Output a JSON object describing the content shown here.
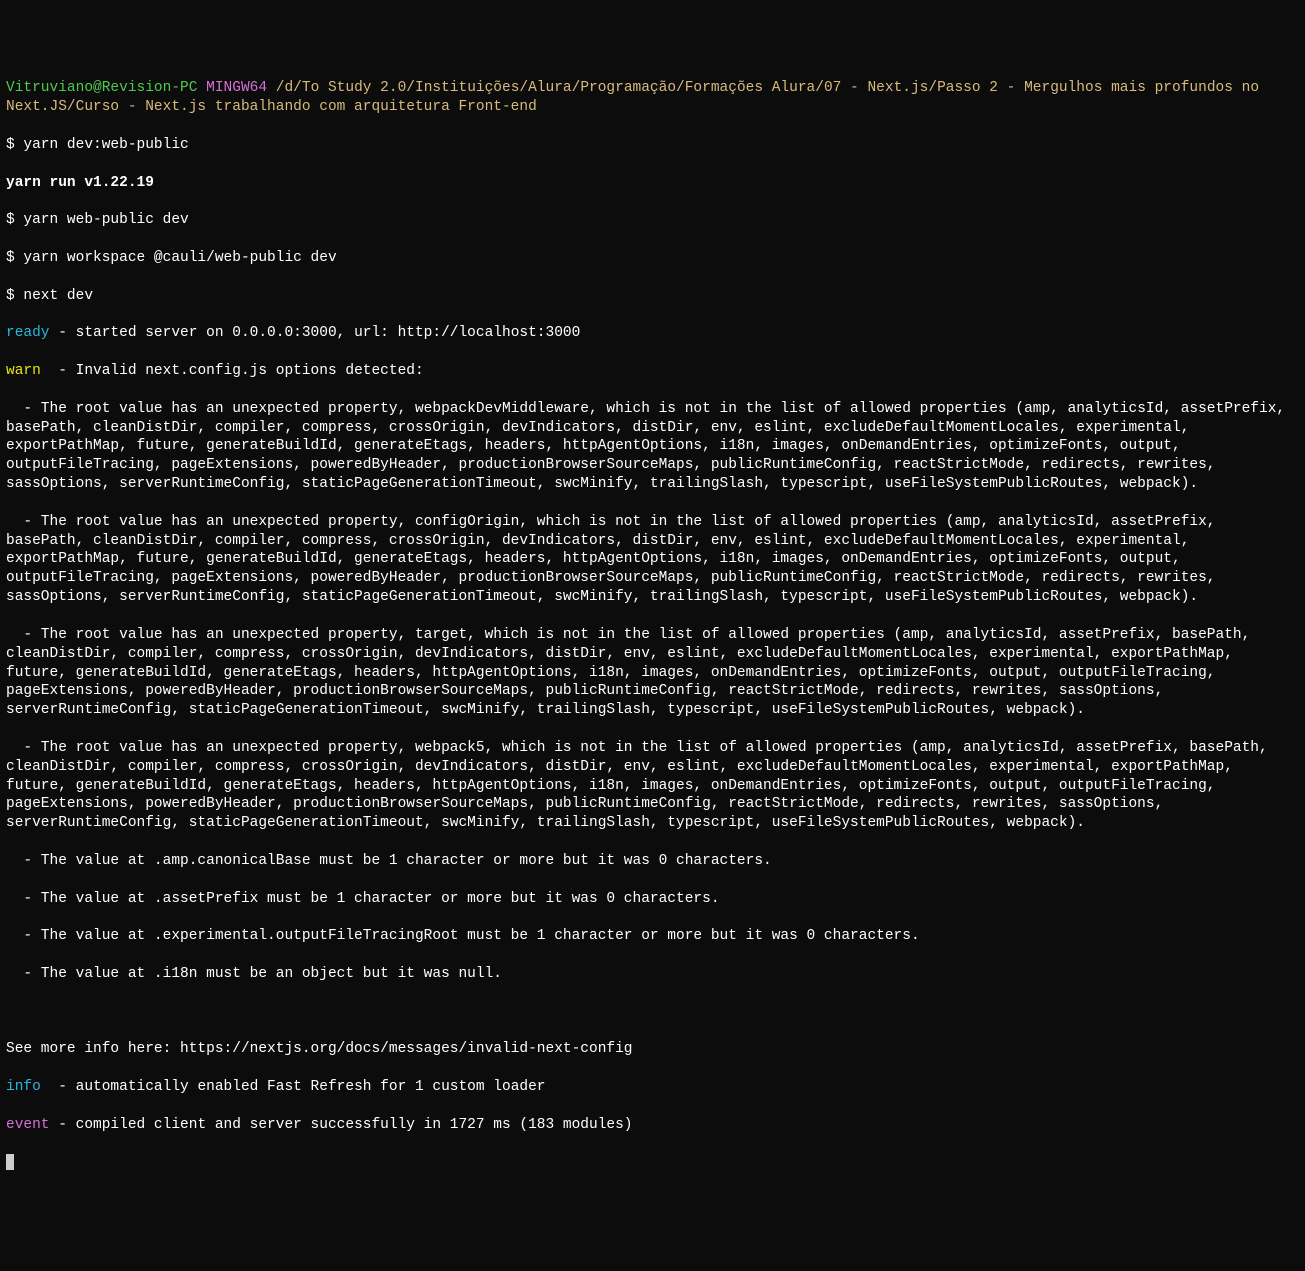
{
  "prompt": {
    "user": "Vitruviano@Revision-PC",
    "mingw": "MINGW64",
    "path": "/d/To Study 2.0/Instituições/Alura/Programação/Formações Alura/07 - Next.js/Passo 2 - Mergulhos mais profundos no Next.JS/Curso - Next.js trabalhando com arquitetura Front-end"
  },
  "commands": {
    "cmd1": "$ yarn dev:web-public",
    "yarn_run": "yarn run v1.22.19",
    "cmd2": "$ yarn web-public dev",
    "cmd3": "$ yarn workspace @cauli/web-public dev",
    "cmd4": "$ next dev"
  },
  "status": {
    "ready_label": "ready",
    "ready_text": " - started server on 0.0.0.0:3000, url: http://localhost:3000",
    "warn_label": "warn",
    "warn_text": "  - Invalid next.config.js options detected:"
  },
  "warnings": {
    "w1": "  - The root value has an unexpected property, webpackDevMiddleware, which is not in the list of allowed properties (amp, analyticsId, assetPrefix, basePath, cleanDistDir, compiler, compress, crossOrigin, devIndicators, distDir, env, eslint, excludeDefaultMomentLocales, experimental, exportPathMap, future, generateBuildId, generateEtags, headers, httpAgentOptions, i18n, images, onDemandEntries, optimizeFonts, output, outputFileTracing, pageExtensions, poweredByHeader, productionBrowserSourceMaps, publicRuntimeConfig, reactStrictMode, redirects, rewrites, sassOptions, serverRuntimeConfig, staticPageGenerationTimeout, swcMinify, trailingSlash, typescript, useFileSystemPublicRoutes, webpack).",
    "w2": "  - The root value has an unexpected property, configOrigin, which is not in the list of allowed properties (amp, analyticsId, assetPrefix, basePath, cleanDistDir, compiler, compress, crossOrigin, devIndicators, distDir, env, eslint, excludeDefaultMomentLocales, experimental, exportPathMap, future, generateBuildId, generateEtags, headers, httpAgentOptions, i18n, images, onDemandEntries, optimizeFonts, output, outputFileTracing, pageExtensions, poweredByHeader, productionBrowserSourceMaps, publicRuntimeConfig, reactStrictMode, redirects, rewrites, sassOptions, serverRuntimeConfig, staticPageGenerationTimeout, swcMinify, trailingSlash, typescript, useFileSystemPublicRoutes, webpack).",
    "w3": "  - The root value has an unexpected property, target, which is not in the list of allowed properties (amp, analyticsId, assetPrefix, basePath, cleanDistDir, compiler, compress, crossOrigin, devIndicators, distDir, env, eslint, excludeDefaultMomentLocales, experimental, exportPathMap, future, generateBuildId, generateEtags, headers, httpAgentOptions, i18n, images, onDemandEntries, optimizeFonts, output, outputFileTracing, pageExtensions, poweredByHeader, productionBrowserSourceMaps, publicRuntimeConfig, reactStrictMode, redirects, rewrites, sassOptions, serverRuntimeConfig, staticPageGenerationTimeout, swcMinify, trailingSlash, typescript, useFileSystemPublicRoutes, webpack).",
    "w4": "  - The root value has an unexpected property, webpack5, which is not in the list of allowed properties (amp, analyticsId, assetPrefix, basePath, cleanDistDir, compiler, compress, crossOrigin, devIndicators, distDir, env, eslint, excludeDefaultMomentLocales, experimental, exportPathMap, future, generateBuildId, generateEtags, headers, httpAgentOptions, i18n, images, onDemandEntries, optimizeFonts, output, outputFileTracing, pageExtensions, poweredByHeader, productionBrowserSourceMaps, publicRuntimeConfig, reactStrictMode, redirects, rewrites, sassOptions, serverRuntimeConfig, staticPageGenerationTimeout, swcMinify, trailingSlash, typescript, useFileSystemPublicRoutes, webpack).",
    "w5": "  - The value at .amp.canonicalBase must be 1 character or more but it was 0 characters.",
    "w6": "  - The value at .assetPrefix must be 1 character or more but it was 0 characters.",
    "w7": "  - The value at .experimental.outputFileTracingRoot must be 1 character or more but it was 0 characters.",
    "w8": "  - The value at .i18n must be an object but it was null."
  },
  "footer": {
    "see_more": "See more info here: https://nextjs.org/docs/messages/invalid-next-config",
    "info_label": "info",
    "info_text": "  - automatically enabled Fast Refresh for 1 custom loader",
    "event_label": "event",
    "event_text": " - compiled client and server successfully in 1727 ms (183 modules)"
  }
}
